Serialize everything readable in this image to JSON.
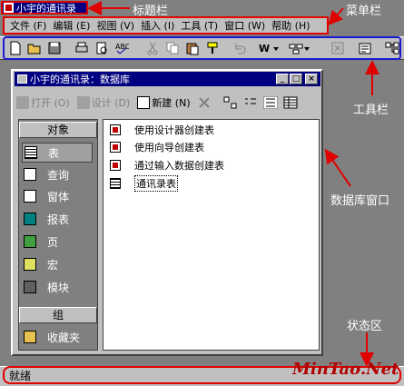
{
  "app": {
    "title": "小宇的通讯录"
  },
  "menu": {
    "items": [
      "文件 (F)",
      "编辑 (E)",
      "视图 (V)",
      "插入 (I)",
      "工具 (T)",
      "窗口 (W)",
      "帮助 (H)"
    ]
  },
  "annotations": {
    "title_bar": "标题栏",
    "menu_bar": "菜单栏",
    "toolbar": "工具栏",
    "db_window": "数据库窗口",
    "status_area": "状态区"
  },
  "db_window": {
    "title": "小宇的通讯录：数据库",
    "toolbar": {
      "open": "打开 (O)",
      "design": "设计 (D)",
      "new": "新建 (N)"
    },
    "objects_header": "对象",
    "objects": [
      "表",
      "查询",
      "窗体",
      "报表",
      "页",
      "宏",
      "模块"
    ],
    "groups_header": "组",
    "groups": [
      "收藏夹"
    ],
    "list_items": [
      "使用设计器创建表",
      "使用向导创建表",
      "通过输入数据创建表",
      "通讯录表"
    ]
  },
  "status": {
    "text": "就绪"
  },
  "watermark": "MinTao.Net",
  "colors": {
    "annotation_red": "#e00000",
    "toolbar_frame_blue": "#1a1ad0",
    "title_blue": "#000080",
    "face_grey": "#c0c0c0"
  }
}
